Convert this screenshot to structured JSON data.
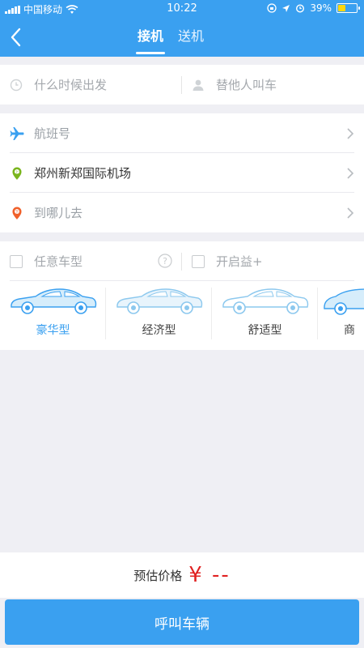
{
  "status": {
    "carrier": "中国移动",
    "time": "10:22",
    "battery": "39%"
  },
  "header": {
    "tabs": [
      "接机",
      "送机"
    ]
  },
  "trip": {
    "time_placeholder": "什么时候出发",
    "other_placeholder": "替他人叫车"
  },
  "route": {
    "flight_placeholder": "航班号",
    "from_value": "郑州新郑国际机场",
    "to_placeholder": "到哪儿去"
  },
  "options": {
    "any_type": "任意车型",
    "yixiang": "开启益+"
  },
  "car_types": [
    {
      "label": "豪华型",
      "active": true
    },
    {
      "label": "经济型",
      "active": false
    },
    {
      "label": "舒适型",
      "active": false
    },
    {
      "label": "商",
      "active": false
    }
  ],
  "footer": {
    "price_label": "预估价格",
    "price_value": "¥ --",
    "call_button": "呼叫车辆"
  },
  "colors": {
    "primary": "#3aa0f0",
    "price_red": "#e02020",
    "bg": "#efeff4"
  }
}
